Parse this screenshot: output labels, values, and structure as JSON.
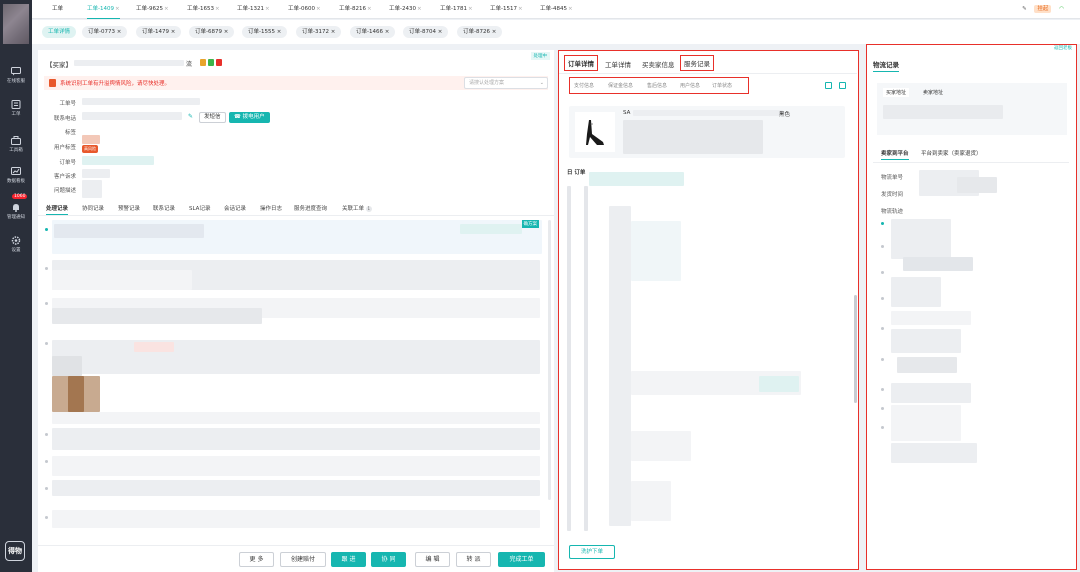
{
  "rail": {
    "items": [
      {
        "label": "在线客服",
        "icon": "chat-icon"
      },
      {
        "label": "工单",
        "icon": "ticket-icon"
      },
      {
        "label": "工具箱",
        "icon": "toolbox-icon"
      },
      {
        "label": "数据看板",
        "icon": "dashboard-icon"
      },
      {
        "label": "管理通知",
        "icon": "bell-icon",
        "badge": "1060"
      },
      {
        "label": "设置",
        "icon": "gear-icon"
      }
    ],
    "logo_text": "得物"
  },
  "top_tabs": [
    {
      "label": "工单"
    },
    {
      "label": "工单-1409"
    },
    {
      "label": "工单-9625"
    },
    {
      "label": "工单-1653"
    },
    {
      "label": "工单-1321"
    },
    {
      "label": "工单-0600"
    },
    {
      "label": "工单-8216"
    },
    {
      "label": "工单-2430"
    },
    {
      "label": "工单-1781"
    },
    {
      "label": "工单-1517"
    },
    {
      "label": "工单-4845"
    }
  ],
  "top_right": {
    "status_tag": "挂起"
  },
  "sub_tabs": [
    {
      "label": "工单详情"
    },
    {
      "label": "订单-0773"
    },
    {
      "label": "订单-1479"
    },
    {
      "label": "订单-6879"
    },
    {
      "label": "订单-1555"
    },
    {
      "label": "订单-3172"
    },
    {
      "label": "订单-1466"
    },
    {
      "label": "订单-8704"
    },
    {
      "label": "订单-8726"
    }
  ],
  "left": {
    "case_prefix": "【买家】",
    "case_suffix": "流",
    "handle_tip": "处理中",
    "warning": "系统识别工单有升溢舆情风险，请尽快处理。",
    "plan_placeholder": "请搜认处理方案",
    "fields": [
      "工单号",
      "联系电话",
      "标签",
      "用户标签",
      "订单号",
      "客户诉求",
      "问题描述"
    ],
    "sms_button": "发短信",
    "call_button": "拨电用户",
    "user_tag_badge": "高风险",
    "record_tabs": [
      "处理记录",
      "协同记录",
      "预警记录",
      "联系记录",
      "SLA记录",
      "会话记录",
      "操作日志",
      "服务进度查询",
      "关联工单"
    ],
    "related_count": "1",
    "plan_badge": "确方案",
    "buttons": {
      "more": "更 多",
      "create_comp": "创建赔付",
      "follow": "跟 进",
      "assist": "协 同",
      "edit": "编 辑",
      "transfer": "转 派",
      "finish": "完成工单"
    }
  },
  "mid": {
    "tabs": [
      "订单详情",
      "工单详情",
      "买卖家信息",
      "服务记录"
    ],
    "sub_tabs": [
      "支付信息",
      "保证金信息",
      "售后信息",
      "用户信息",
      "订单状态"
    ],
    "product_code_prefix": "SA",
    "product_color": "黑色",
    "order_section": "订单",
    "reorder_button": "洗护下单"
  },
  "right": {
    "title": "物流记录",
    "top_link": "返回老板",
    "addr_tabs": [
      "买家地址",
      "卖家地址"
    ],
    "logistics_tabs": [
      "卖家到平台",
      "平台到卖家（卖家退货）"
    ],
    "labels": [
      "物流单号",
      "发货时间",
      "物流轨迹"
    ]
  }
}
